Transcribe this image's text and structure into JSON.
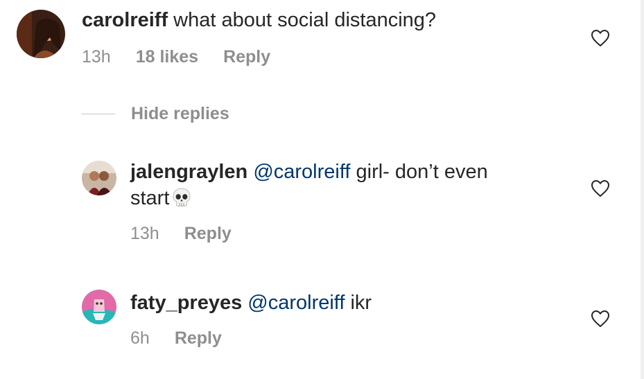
{
  "thread": {
    "parent": {
      "username": "carolreiff",
      "text": "what about social distancing?",
      "time": "13h",
      "likes": "18 likes",
      "reply_label": "Reply",
      "avatar_icon": "profile-photo-avatar",
      "like_icon": "heart-outline-icon"
    },
    "hide_replies_label": "Hide replies",
    "replies": [
      {
        "username": "jalengraylen",
        "mention": "@carolreiff",
        "text_line1": "girl- don’t even",
        "text_line2": "start",
        "emoji": "skull-emoji",
        "time": "13h",
        "reply_label": "Reply",
        "avatar_icon": "profile-photo-avatar",
        "like_icon": "heart-outline-icon"
      },
      {
        "username": "faty_preyes",
        "mention": "@carolreiff",
        "text": "ikr",
        "time": "6h",
        "reply_label": "Reply",
        "avatar_icon": "profile-photo-avatar",
        "like_icon": "heart-outline-icon"
      }
    ]
  },
  "colors": {
    "text": "#262626",
    "secondary": "#8e8e8e",
    "mention": "#00376b",
    "divider": "#c7c7c7"
  }
}
